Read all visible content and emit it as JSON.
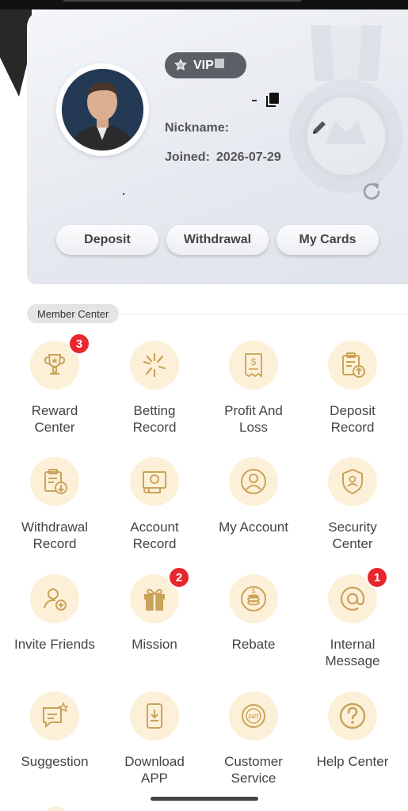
{
  "profile": {
    "vip_label": "VIP",
    "nickname_label": "Nickname:",
    "nickname_value": "",
    "joined_label": "Joined:",
    "joined_date": "2026-07-29",
    "avatar_icon": "user-avatar-photo",
    "copy_icon": "copy-icon",
    "edit_icon": "pencil-icon",
    "refresh_icon": "refresh-icon"
  },
  "actions": {
    "deposit": "Deposit",
    "withdrawal": "Withdrawal",
    "my_cards": "My Cards"
  },
  "member_center": {
    "title": "Member Center",
    "items": [
      {
        "label": "Reward\nCenter",
        "icon": "trophy-icon",
        "badge": "3"
      },
      {
        "label": "Betting\nRecord",
        "icon": "starburst-icon",
        "badge": ""
      },
      {
        "label": "Profit And\nLoss",
        "icon": "dollar-receipt-icon",
        "badge": ""
      },
      {
        "label": "Deposit\nRecord",
        "icon": "clipboard-upload-icon",
        "badge": ""
      },
      {
        "label": "Withdrawal\nRecord",
        "icon": "clipboard-download-icon",
        "badge": ""
      },
      {
        "label": "Account\nRecord",
        "icon": "certificate-icon",
        "badge": ""
      },
      {
        "label": "My Account",
        "icon": "user-circle-icon",
        "badge": ""
      },
      {
        "label": "Security\nCenter",
        "icon": "shield-user-icon",
        "badge": ""
      },
      {
        "label": "Invite Friends",
        "icon": "add-user-icon",
        "badge": ""
      },
      {
        "label": "Mission",
        "icon": "gift-icon",
        "badge": "2"
      },
      {
        "label": "Rebate",
        "icon": "coins-icon",
        "badge": ""
      },
      {
        "label": "Internal\nMessage",
        "icon": "at-sign-icon",
        "badge": "1"
      },
      {
        "label": "Suggestion",
        "icon": "chat-star-icon",
        "badge": ""
      },
      {
        "label": "Download\nAPP",
        "icon": "phone-download-icon",
        "badge": ""
      },
      {
        "label": "Customer\nService",
        "icon": "support-247-icon",
        "badge": ""
      },
      {
        "label": "Help Center",
        "icon": "question-circle-icon",
        "badge": ""
      }
    ]
  },
  "colors": {
    "accent_gold": "#c9a35a",
    "icon_bg": "#fdf0d8",
    "badge_red": "#e8262d",
    "vip_pill": "#5c5f66"
  }
}
